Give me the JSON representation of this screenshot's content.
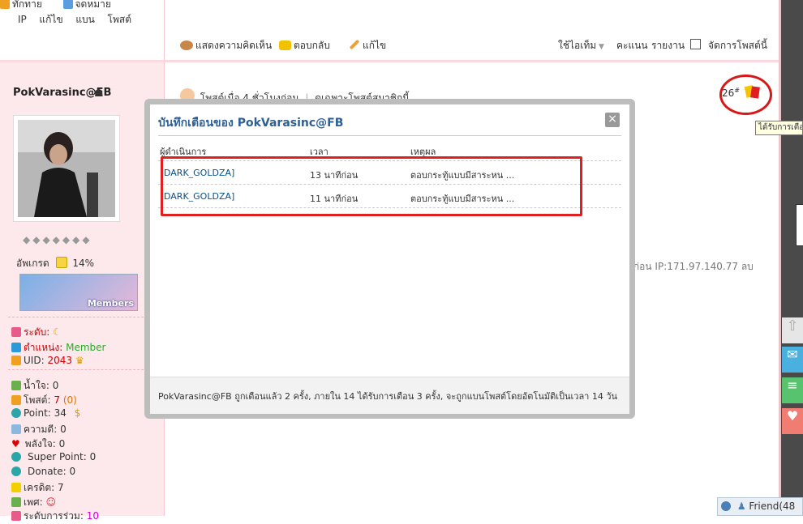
{
  "top_left": {
    "thanks_label": "ทักทาย",
    "message_label": "จดหมาย",
    "links": [
      "IP",
      "แก้ไข",
      "แบน",
      "โพสต์"
    ]
  },
  "post_actions": {
    "comment": "แสดงความคิดเห็น",
    "reply": "ตอบกลับ",
    "edit": "แก้ไข",
    "use_item": "ใช้ไอเท็ม",
    "rate": "คะแนน",
    "report": "รายงาน",
    "manage": "จัดการโพสต์นี้"
  },
  "user": {
    "name": "PokVarasinc@FB",
    "upgrade_label": "อัพเกรด",
    "upgrade_percent": "14%",
    "badge_text": "Members",
    "level_label": "ระดับ:",
    "position_label": "ตำแหน่ง:",
    "position_value": "Member",
    "uid_label": "UID:",
    "uid_value": "2043",
    "stats": [
      {
        "label": "น้ำใจ:",
        "value": "0"
      },
      {
        "label": "โพสต์:",
        "value": "7",
        "extra": "(0)"
      },
      {
        "label": "Point:",
        "value": "34"
      },
      {
        "label": "ความดี:",
        "value": "0"
      },
      {
        "label": "พลังใจ:",
        "value": "0"
      },
      {
        "label": "Super Point:",
        "value": "0"
      },
      {
        "label": "Donate:",
        "value": "0"
      },
      {
        "label": "เครดิต:",
        "value": "7"
      },
      {
        "label": "เพศ:",
        "value": ""
      },
      {
        "label": "ระดับการร่วม:",
        "value": "10"
      }
    ]
  },
  "post_header": {
    "posted": "โพสต์เมื่อ 4 ชั่วโมงก่อน",
    "only_member": "ดูเฉพาะโพสต์สมาชิกนี้",
    "post_number": "26",
    "post_number_sup": "#",
    "tooltip": "ได้รับการเตือน",
    "ip_info": "ที่ก่อน IP:171.97.140.77 ลบ"
  },
  "modal": {
    "title": "บันทึกเตือนของ PokVarasinc@FB",
    "close": "×",
    "columns": [
      "ผู้ดำเนินการ",
      "เวลา",
      "เหตุผล"
    ],
    "rows": [
      {
        "operator": "DARK_GOLDZA]",
        "time": "13 นาทีก่อน",
        "reason": "ตอบกระทู้แบบมีสาระหน ..."
      },
      {
        "operator": "DARK_GOLDZA]",
        "time": "11 นาทีก่อน",
        "reason": "ตอบกระทู้แบบมีสาระหน ..."
      }
    ],
    "footer": "PokVarasinc@FB ถูกเตือนแล้ว 2 ครั้ง, ภายใน 14 ได้รับการเตือน 3 ครั้ง, จะถูกแบนโพสต์โดยอัตโนมัติเป็นเวลา 14 วัน"
  },
  "friend_bar": {
    "label": "Friend(48"
  },
  "colors": {
    "accent_red": "#e02020",
    "title_blue": "#2f5f93",
    "sidebar_pink": "#fde9ec"
  }
}
